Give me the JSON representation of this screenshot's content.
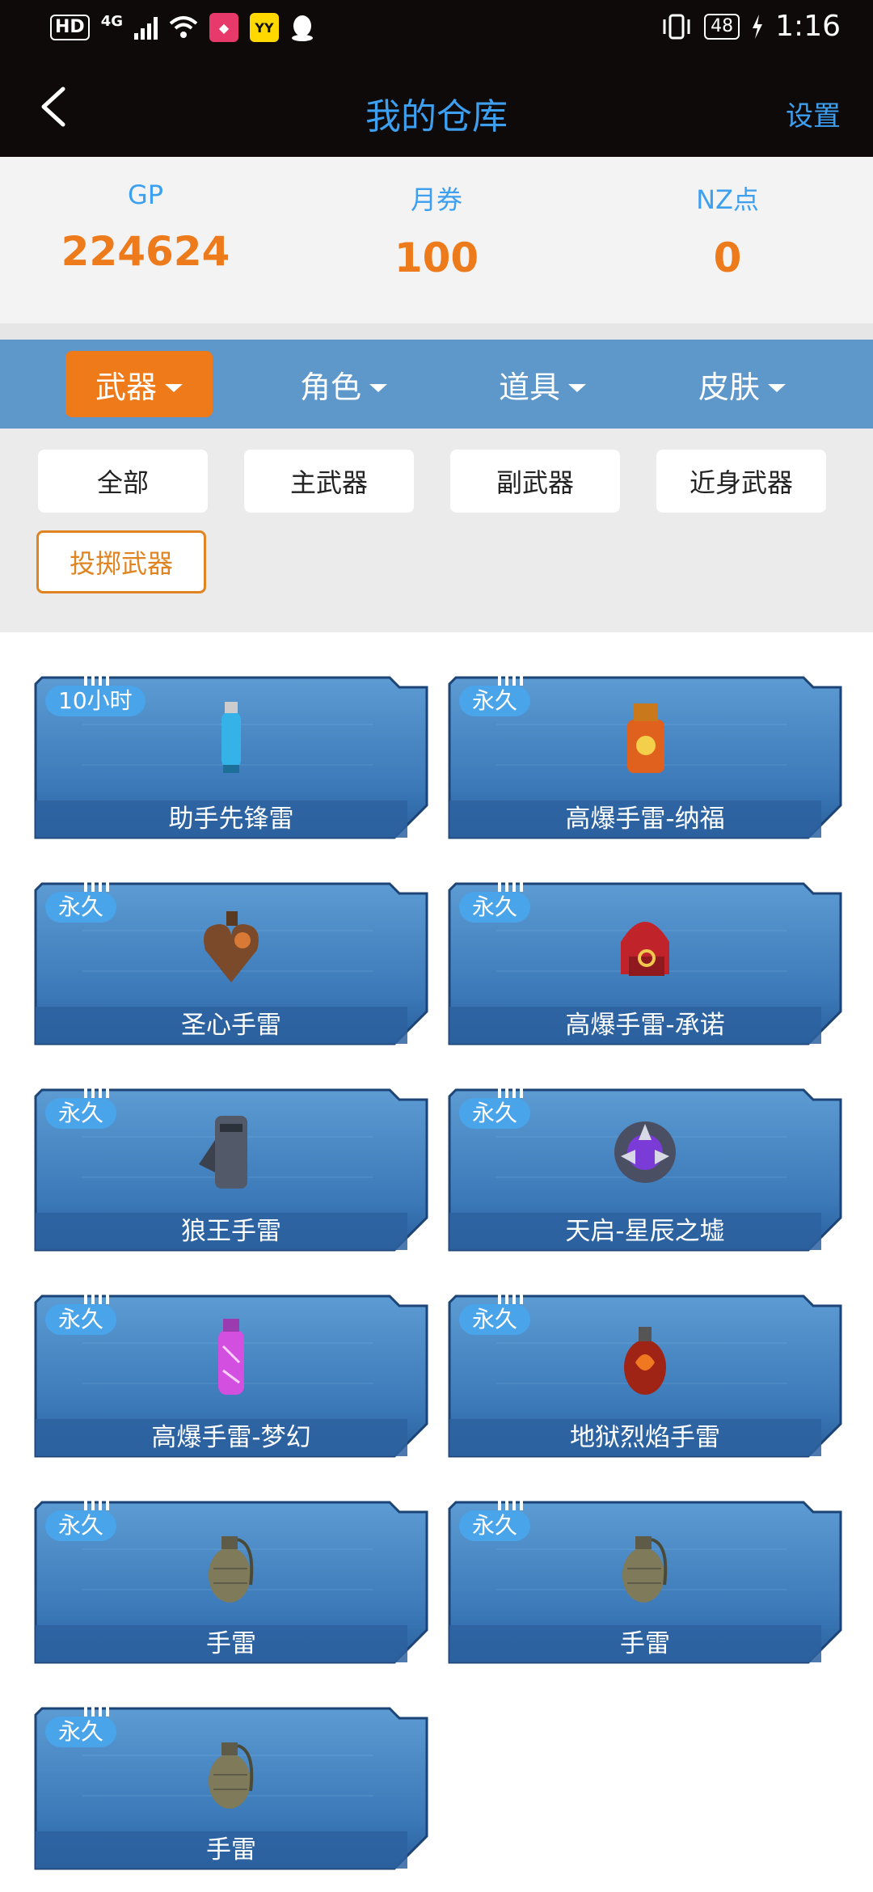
{
  "status_bar": {
    "hd": "HD",
    "network": "4G",
    "battery": "48",
    "time": "1:16"
  },
  "header": {
    "title": "我的仓库",
    "settings_label": "设置"
  },
  "currency": [
    {
      "label": "GP",
      "value": "224624"
    },
    {
      "label": "月券",
      "value": "100"
    },
    {
      "label": "NZ点",
      "value": "0"
    }
  ],
  "categories": [
    {
      "label": "武器",
      "active": true
    },
    {
      "label": "角色",
      "active": false
    },
    {
      "label": "道具",
      "active": false
    },
    {
      "label": "皮肤",
      "active": false
    }
  ],
  "sub_filters": [
    {
      "label": "全部",
      "active": false
    },
    {
      "label": "主武器",
      "active": false
    },
    {
      "label": "副武器",
      "active": false
    },
    {
      "label": "近身武器",
      "active": false
    },
    {
      "label": "投掷武器",
      "active": true
    }
  ],
  "items": [
    {
      "name": "助手先锋雷",
      "duration": "10小时",
      "icon": "blue-grenade-icon"
    },
    {
      "name": "高爆手雷-纳福",
      "duration": "永久",
      "icon": "lucky-grenade-icon"
    },
    {
      "name": "圣心手雷",
      "duration": "永久",
      "icon": "heart-grenade-icon"
    },
    {
      "name": "高爆手雷-承诺",
      "duration": "永久",
      "icon": "ring-box-grenade-icon"
    },
    {
      "name": "狼王手雷",
      "duration": "永久",
      "icon": "wolf-grenade-icon"
    },
    {
      "name": "天启-星辰之墟",
      "duration": "永久",
      "icon": "star-orb-grenade-icon"
    },
    {
      "name": "高爆手雷-梦幻",
      "duration": "永久",
      "icon": "crystal-grenade-icon"
    },
    {
      "name": "地狱烈焰手雷",
      "duration": "永久",
      "icon": "flame-grenade-icon"
    },
    {
      "name": "手雷",
      "duration": "永久",
      "icon": "frag-grenade-icon"
    },
    {
      "name": "手雷",
      "duration": "永久",
      "icon": "frag-grenade-icon"
    },
    {
      "name": "手雷",
      "duration": "永久",
      "icon": "frag-grenade-icon"
    }
  ],
  "colors": {
    "accent_blue": "#3d9ff0",
    "accent_orange": "#ef7a1a",
    "tab_bar": "#5e97c9",
    "card_blue": "#3a78b8"
  }
}
